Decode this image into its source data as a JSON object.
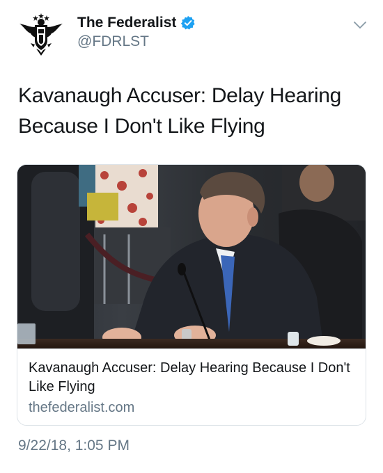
{
  "author": {
    "name": "The Federalist",
    "handle": "@FDRLST",
    "verified": true,
    "avatar_icon": "eagle-logo-icon"
  },
  "tweet": {
    "text": "Kavanaugh Accuser: Delay Hearing Because I Don't Like Flying",
    "timestamp": "9/22/18, 1:05 PM"
  },
  "card": {
    "title": "Kavanaugh Accuser: Delay Hearing Because I Don't Like Flying",
    "domain": "thefederalist.com",
    "image_icon": "article-photo"
  },
  "colors": {
    "verified_blue": "#1da1f2",
    "secondary_text": "#657786",
    "primary_text": "#14171a",
    "border": "#dde3e8"
  }
}
